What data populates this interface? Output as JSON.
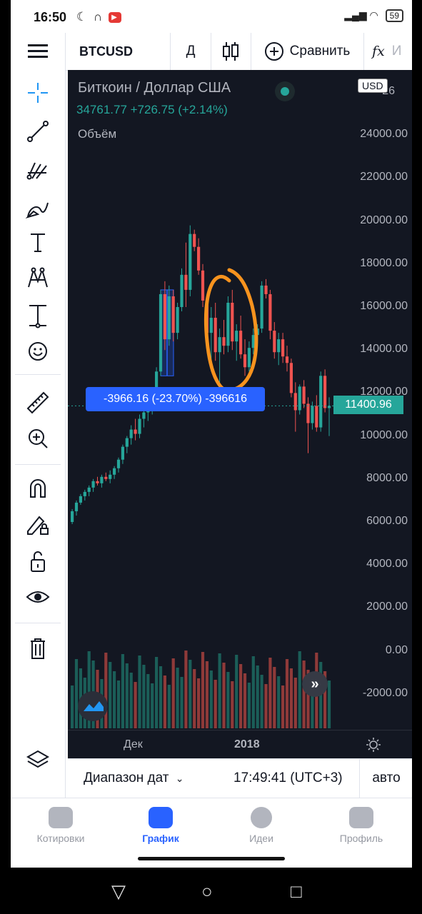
{
  "status_bar": {
    "time": "16:50",
    "battery": "59"
  },
  "toolbar": {
    "symbol": "BTCUSD",
    "interval": "Д",
    "compare_label": "Сравнить",
    "fx_label": "fx",
    "cut_label": "И"
  },
  "chart": {
    "title": "Биткоин / Доллар США",
    "price_line": "34761.77 +726.75 (+2.14%)",
    "volume_label": "Объём",
    "currency": "USD",
    "y_ticks": [
      "26000.00",
      "24000.00",
      "22000.00",
      "20000.00",
      "18000.00",
      "16000.00",
      "14000.00",
      "12000.00",
      "10000.00",
      "8000.00",
      "6000.00",
      "4000.00",
      "2000.00",
      "0.00",
      "-2000.00"
    ],
    "top_tick_partial": "26",
    "last_price": "11400.96",
    "measure_label": "-3966.16 (-23.70%) -396616",
    "x_ticks": [
      "Дек",
      "2018"
    ],
    "colors": {
      "up": "#26a69a",
      "down": "#ef5350",
      "background": "#131722",
      "accent": "#2962ff",
      "annotation": "#f7931e"
    }
  },
  "chart_data": {
    "type": "candlestick",
    "title": "Биткоин / Доллар США",
    "ylim": [
      -3500,
      27000
    ],
    "x_ticks": [
      "Дек",
      "2018"
    ],
    "candles_ohlc": [
      [
        6000,
        6600,
        5900,
        6500
      ],
      [
        6500,
        7000,
        6300,
        6900
      ],
      [
        6900,
        7300,
        6800,
        7200
      ],
      [
        7200,
        7500,
        7000,
        7400
      ],
      [
        7400,
        7700,
        7200,
        7600
      ],
      [
        7600,
        8000,
        7400,
        7900
      ],
      [
        7900,
        8100,
        7700,
        7800
      ],
      [
        7800,
        8200,
        7600,
        8100
      ],
      [
        8100,
        8300,
        7900,
        8000
      ],
      [
        8000,
        8400,
        7800,
        8200
      ],
      [
        8200,
        8600,
        8000,
        8500
      ],
      [
        8500,
        9000,
        8300,
        8900
      ],
      [
        8900,
        9600,
        8700,
        9500
      ],
      [
        9500,
        10000,
        9200,
        9900
      ],
      [
        9900,
        10500,
        9600,
        10300
      ],
      [
        10300,
        10800,
        9800,
        10100
      ],
      [
        10100,
        11000,
        9900,
        10800
      ],
      [
        10800,
        11200,
        10400,
        11100
      ],
      [
        11100,
        11500,
        10700,
        11300
      ],
      [
        11300,
        12000,
        11000,
        11800
      ],
      [
        11800,
        13200,
        11600,
        13000
      ],
      [
        13000,
        16800,
        12800,
        16600
      ],
      [
        16600,
        17200,
        14000,
        14500
      ],
      [
        14500,
        17000,
        14200,
        16500
      ],
      [
        16500,
        16800,
        14400,
        14800
      ],
      [
        14800,
        16200,
        14500,
        16000
      ],
      [
        16000,
        17800,
        15800,
        17500
      ],
      [
        17500,
        19000,
        16000,
        16800
      ],
      [
        16800,
        19800,
        16500,
        19400
      ],
      [
        19400,
        19600,
        18600,
        18800
      ],
      [
        18800,
        19200,
        17500,
        17700
      ],
      [
        17700,
        18000,
        16000,
        16300
      ],
      [
        16300,
        16500,
        14500,
        14800
      ],
      [
        14800,
        16000,
        13000,
        15500
      ],
      [
        15500,
        16200,
        13500,
        13900
      ],
      [
        13900,
        15000,
        12500,
        14600
      ],
      [
        14600,
        15400,
        13800,
        14200
      ],
      [
        14200,
        16500,
        13900,
        16200
      ],
      [
        16200,
        16800,
        14000,
        14400
      ],
      [
        14400,
        15200,
        13500,
        14900
      ],
      [
        14900,
        15600,
        13600,
        13800
      ],
      [
        13800,
        14500,
        12800,
        13200
      ],
      [
        13200,
        14400,
        13000,
        14100
      ],
      [
        14100,
        15000,
        13800,
        14700
      ],
      [
        14700,
        15200,
        14300,
        15000
      ],
      [
        15000,
        17200,
        14800,
        17000
      ],
      [
        17000,
        17300,
        16400,
        16600
      ],
      [
        16600,
        16800,
        14500,
        14900
      ],
      [
        14900,
        15300,
        13600,
        13900
      ],
      [
        13900,
        14800,
        13300,
        14500
      ],
      [
        14500,
        14800,
        13400,
        13700
      ],
      [
        13700,
        14200,
        13000,
        13400
      ],
      [
        13400,
        13600,
        11800,
        12000
      ],
      [
        12000,
        12500,
        10200,
        11200
      ],
      [
        11200,
        12400,
        11000,
        12300
      ],
      [
        12300,
        12600,
        11300,
        11500
      ],
      [
        11500,
        11800,
        9200,
        10600
      ],
      [
        10600,
        11600,
        10300,
        11400
      ],
      [
        11400,
        11900,
        10200,
        10400
      ],
      [
        10400,
        13000,
        10200,
        12800
      ],
      [
        12800,
        13100,
        11100,
        11300
      ],
      [
        11300,
        11800,
        10000,
        11400
      ]
    ]
  },
  "left_tools": {
    "items": [
      "crosshair-icon",
      "trend-line-icon",
      "fib-icon",
      "brush-icon",
      "text-tool-icon",
      "pattern-icon",
      "measure-range-icon",
      "emoji-icon",
      "ruler-icon",
      "zoom-in-icon",
      "magnet-icon",
      "lock-drawing-icon",
      "unlock-icon",
      "eye-icon",
      "trash-icon",
      "layers-icon"
    ]
  },
  "bottom_info": {
    "date_range": "Диапазон дат",
    "clock": "17:49:41 (UTC+3)",
    "auto": "авто"
  },
  "tabs": [
    {
      "label": "Котировки",
      "icon": "list-icon"
    },
    {
      "label": "График",
      "icon": "chart-icon"
    },
    {
      "label": "Идеи",
      "icon": "bulb-icon"
    },
    {
      "label": "Профиль",
      "icon": "smile-icon"
    }
  ]
}
